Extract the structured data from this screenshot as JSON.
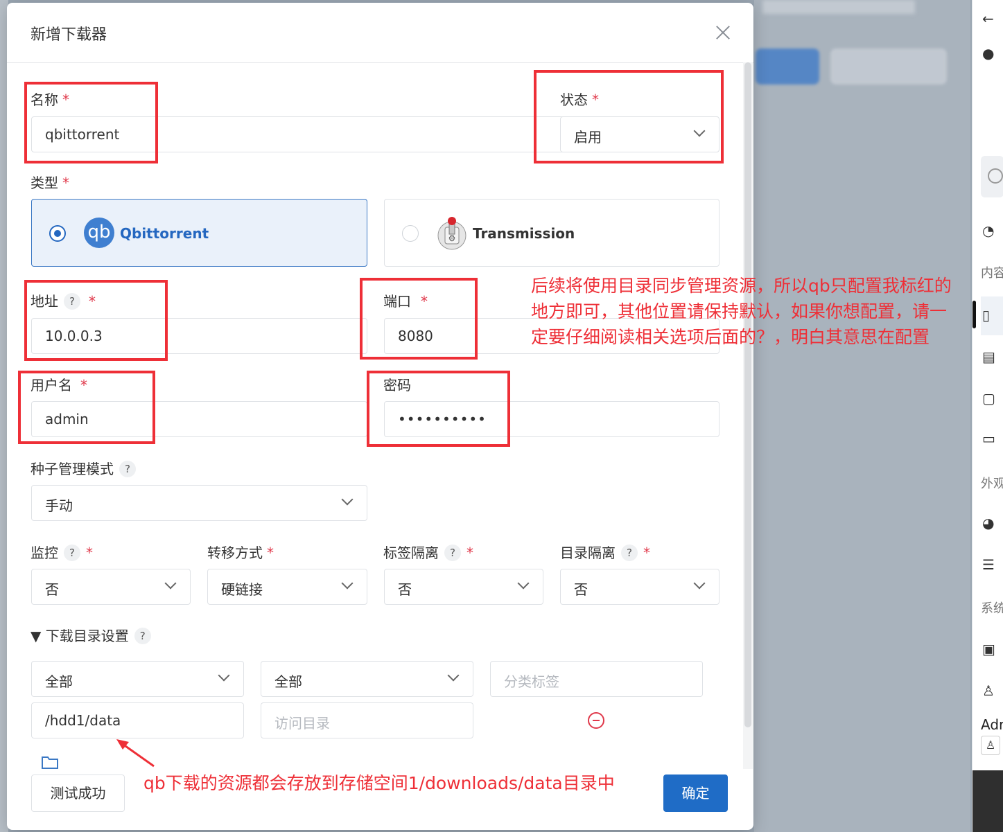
{
  "dialog": {
    "title": "新增下载器",
    "name": {
      "label": "名称",
      "value": "qbittorrent"
    },
    "status": {
      "label": "状态",
      "value": "启用"
    },
    "type": {
      "label": "类型",
      "options": [
        {
          "label": "Qbittorrent",
          "selected": true,
          "icon": "qb-logo"
        },
        {
          "label": "Transmission",
          "selected": false,
          "icon": "transmission-logo"
        }
      ]
    },
    "address": {
      "label": "地址",
      "help": "?",
      "value": "10.0.0.3"
    },
    "port": {
      "label": "端口",
      "value": "8080"
    },
    "username": {
      "label": "用户名",
      "value": "admin"
    },
    "password": {
      "label": "密码",
      "value": "••••••••••"
    },
    "torrent_mode": {
      "label": "种子管理模式",
      "help": "?",
      "value": "手动"
    },
    "monitor": {
      "label": "监控",
      "help": "?",
      "value": "否"
    },
    "transfer": {
      "label": "转移方式",
      "value": "硬链接"
    },
    "tag_isolation": {
      "label": "标签隔离",
      "help": "?",
      "value": "否"
    },
    "dir_isolation": {
      "label": "目录隔离",
      "help": "?",
      "value": "否"
    },
    "download_dir": {
      "toggle_label": "▼ 下载目录设置",
      "help": "?",
      "select1": "全部",
      "select2": "全部",
      "category_placeholder": "分类标签",
      "path_value": "/hdd1/data",
      "access_placeholder": "访问目录"
    },
    "buttons": {
      "test": "测试成功",
      "confirm": "确定"
    },
    "required_mark": "*"
  },
  "annotations": {
    "note_lines": [
      "后续将使用目录同步管理资源，所以qb只配置我标红的",
      "地方即可，其他位置请保持默认，如果你想配置，请一",
      "定要仔细阅读相关选项后面的？，明白其意思在配置"
    ],
    "path_note": "qb下载的资源都会存放到存储空间1/downloads/data目录中",
    "color": "#ee2f37"
  },
  "side_panel": {
    "labels": [
      "内容",
      "外观",
      "系统",
      "Adr"
    ]
  },
  "colors": {
    "primary": "#1f6cc6",
    "selected_bg": "#eaf1fa",
    "required": "#e0384a"
  }
}
